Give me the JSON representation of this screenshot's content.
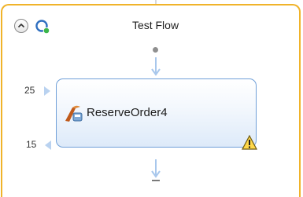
{
  "flow": {
    "title": "Test Flow"
  },
  "step": {
    "label": "ReserveOrder4",
    "input_port": "25",
    "output_port": "15"
  },
  "icons": {
    "collapse": "chevron-up-icon",
    "refresh": "refresh-icon",
    "step": "operation-icon",
    "warning": "warning-icon"
  },
  "colors": {
    "frame_border": "#f0b32a",
    "node_border": "#6f9fd8",
    "connector": "#a8c7ec"
  }
}
